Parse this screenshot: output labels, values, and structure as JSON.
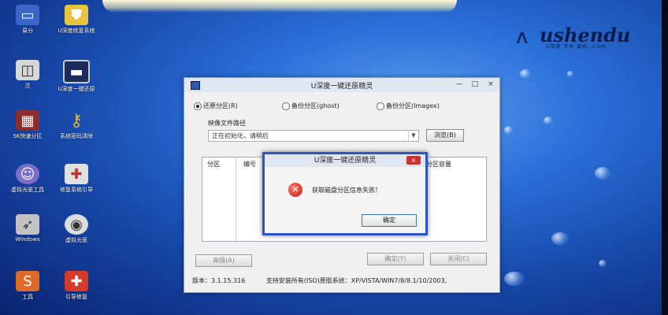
{
  "brand": {
    "name": "ushendu",
    "tagline": "U深度 专业 装机 .COM"
  },
  "desktop_icons": [
    {
      "label": "易分",
      "icon": "monitor-icon",
      "color": "#3a66c9"
    },
    {
      "label": "U深度修复系统",
      "icon": "shield-icon",
      "color": "#e8c43a"
    },
    {
      "label": "注",
      "icon": "app-icon",
      "color": "#d7d7d7"
    },
    {
      "label": "U深度一键还原",
      "icon": "screen-icon",
      "color": "#1b2b5c"
    },
    {
      "label": "SK快速分区",
      "icon": "partition-icon",
      "color": "#8b2d2d"
    },
    {
      "label": "系统密码清除",
      "icon": "key-icon",
      "color": "#e0b43a"
    },
    {
      "label": "虚拟光驱工具",
      "icon": "ghost-icon",
      "color": "#7a6ec9"
    },
    {
      "label": "修复系统引导",
      "icon": "toolbox-icon",
      "color": "#e0e0e0"
    },
    {
      "label": "Windows",
      "icon": "rocket-icon",
      "color": "#c2c2c2"
    },
    {
      "label": "虚拟光驱",
      "icon": "disc-icon",
      "color": "#dcdcdc"
    },
    {
      "label": "工具",
      "icon": "s-logo-icon",
      "color": "#e06a2a"
    },
    {
      "label": "引导修复",
      "icon": "firstaid-icon",
      "color": "#d83a2a"
    }
  ],
  "main_window": {
    "title": "U深度一键还原精灵",
    "min": "—",
    "max": "□",
    "close": "×",
    "radio_restore": "还原分区(R)",
    "radio_backup": "备份分区(ghost)",
    "radio_backup_img": "备份分区(Imagex)",
    "path_label": "映像文件路径",
    "path_value": "正在初始化，请稍后",
    "browse": "浏览(B)",
    "col_partition": "分区",
    "col_number": "编号",
    "col_capacity": "分区容量",
    "advanced": "高级(A)",
    "ok": "确定(Y)",
    "close_btn": "关闭(C)",
    "version": "版本：3.1.15.316",
    "support": "支持安装所有(ISO)原版系统：XP/VISTA/WIN7/8/8.1/10/2003,"
  },
  "error_dialog": {
    "title": "U深度一键还原精灵",
    "close": "×",
    "message": "获取磁盘分区信息失败！",
    "ok": "确定"
  }
}
